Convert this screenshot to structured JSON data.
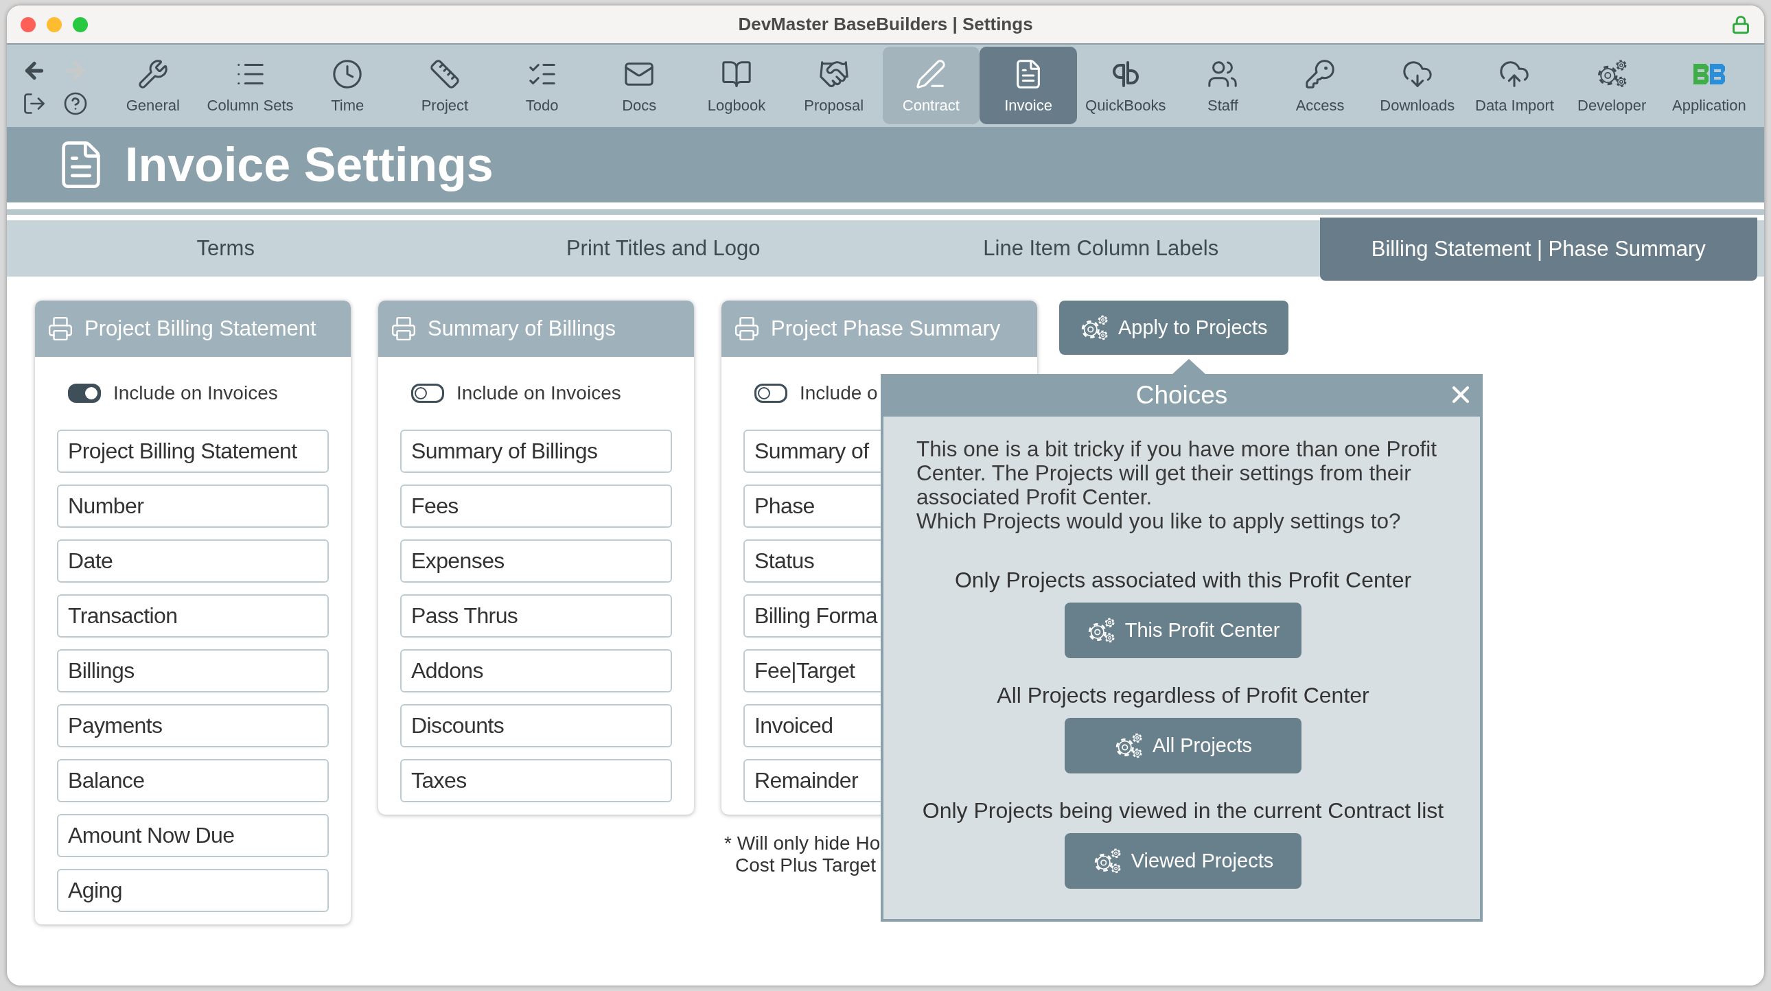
{
  "window": {
    "title": "DevMaster BaseBuilders | Settings"
  },
  "nav_buttons": [
    {
      "kind": "back",
      "disabled": false
    },
    {
      "kind": "forward",
      "disabled": true
    },
    {
      "kind": "exit",
      "disabled": false
    },
    {
      "kind": "help",
      "disabled": false
    }
  ],
  "toolbar": [
    {
      "label": "General",
      "selected": false,
      "hovered": false
    },
    {
      "label": "Column Sets",
      "selected": false,
      "hovered": false
    },
    {
      "label": "Time",
      "selected": false,
      "hovered": false
    },
    {
      "label": "Project",
      "selected": false,
      "hovered": false
    },
    {
      "label": "Todo",
      "selected": false,
      "hovered": false
    },
    {
      "label": "Docs",
      "selected": false,
      "hovered": false
    },
    {
      "label": "Logbook",
      "selected": false,
      "hovered": false
    },
    {
      "label": "Proposal",
      "selected": false,
      "hovered": false
    },
    {
      "label": "Contract",
      "selected": false,
      "hovered": true
    },
    {
      "label": "Invoice",
      "selected": true,
      "hovered": false
    },
    {
      "label": "QuickBooks",
      "selected": false,
      "hovered": false
    },
    {
      "label": "Staff",
      "selected": false,
      "hovered": false
    },
    {
      "label": "Access",
      "selected": false,
      "hovered": false
    },
    {
      "label": "Downloads",
      "selected": false,
      "hovered": false
    },
    {
      "label": "Data Import",
      "selected": false,
      "hovered": false
    },
    {
      "label": "Developer",
      "selected": false,
      "hovered": false
    },
    {
      "label": "Application",
      "selected": false,
      "hovered": false
    }
  ],
  "header": {
    "title": "Invoice Settings"
  },
  "tabs": [
    {
      "label": "Terms",
      "selected": false
    },
    {
      "label": "Print Titles and Logo",
      "selected": false
    },
    {
      "label": "Line Item Column Labels",
      "selected": false
    },
    {
      "label": "Billing Statement | Phase Summary",
      "selected": true
    }
  ],
  "cards": [
    {
      "title": "Project Billing Statement",
      "toggle": {
        "label": "Include on Invoices",
        "on": true
      },
      "fields": [
        "Project Billing Statement",
        "Number",
        "Date",
        "Transaction",
        "Billings",
        "Payments",
        "Balance",
        "Amount Now Due",
        "Aging"
      ]
    },
    {
      "title": "Summary of Billings",
      "toggle": {
        "label": "Include on Invoices",
        "on": false
      },
      "fields": [
        "Summary of Billings",
        "Fees",
        "Expenses",
        "Pass Thrus",
        "Addons",
        "Discounts",
        "Taxes"
      ]
    },
    {
      "title": "Project Phase Summary",
      "toggle": {
        "label": "Include o",
        "on": false
      },
      "fields": [
        "Summary of",
        "Phase",
        "Status",
        "Billing Forma",
        "Fee|Target",
        "Invoiced",
        "Remainder"
      ],
      "note_lines": [
        "* Will only hide Ho",
        "Cost Plus Target"
      ]
    }
  ],
  "apply_button": {
    "label": "Apply to Projects"
  },
  "popover": {
    "title": "Choices",
    "message": [
      "This one is a bit tricky if you have more than one Profit Center. The Projects will get their settings from their associated Profit Center.",
      "Which Projects would you like to apply settings to?"
    ],
    "choices": [
      {
        "prompt": "Only Projects associated with this Profit Center",
        "button": "This Profit Center"
      },
      {
        "prompt": "All Projects regardless of Profit Center",
        "button": "All Projects"
      },
      {
        "prompt": "Only Projects being viewed in the current Contract list",
        "button": "Viewed Projects"
      }
    ]
  }
}
